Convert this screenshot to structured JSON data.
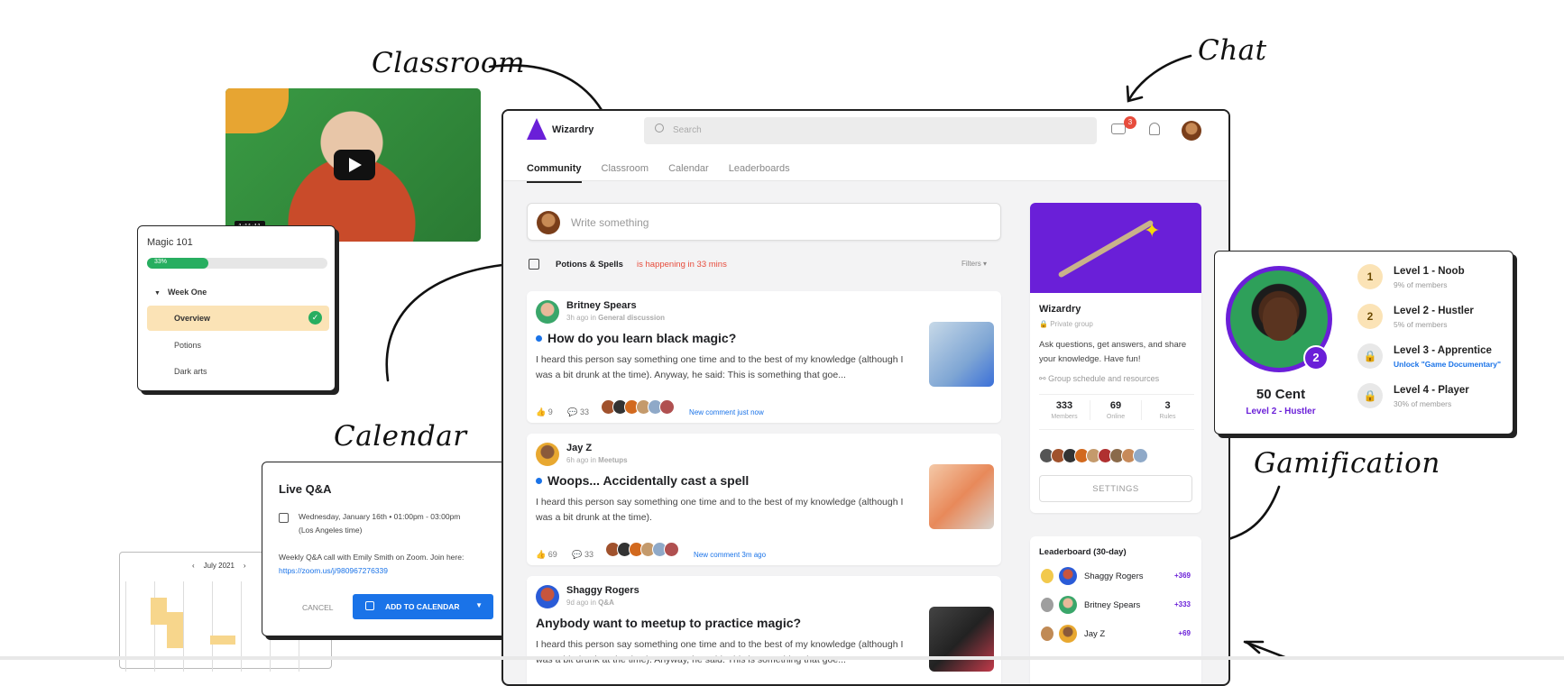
{
  "annotations": {
    "classroom": "Classroom",
    "chat": "Chat",
    "calendar": "Calendar",
    "gamification": "Gamification"
  },
  "video": {
    "timestamp": "1:11:11"
  },
  "course": {
    "title": "Magic 101",
    "progress_label": "33%",
    "progress_value": 0.33,
    "section": "Week One",
    "lessons": [
      "Overview",
      "Potions",
      "Dark arts"
    ]
  },
  "event": {
    "title": "Live Q&A",
    "datetime": "Wednesday, January 16th • 01:00pm - 03:00pm",
    "timezone": "(Los Angeles time)",
    "description": "Weekly Q&A call with Emily Smith on Zoom. Join here:",
    "link": "https://zoom.us/j/980967276339",
    "cancel_label": "CANCEL",
    "add_label": "ADD TO CALENDAR"
  },
  "calendar_widget": {
    "month": "July 2021"
  },
  "app": {
    "name": "Wizardry",
    "search_placeholder": "Search",
    "chat_badge": "3",
    "tabs": [
      "Community",
      "Classroom",
      "Calendar",
      "Leaderboards"
    ],
    "composer_placeholder": "Write something",
    "banner_event": "Potions & Spells",
    "banner_status": "is happening in 33 mins",
    "filters_label": "Filters",
    "posts": [
      {
        "author": "Britney Spears",
        "meta_time": "3h ago in",
        "meta_category": "General discussion",
        "title": "How do you learn black magic?",
        "body": "I heard this person say something one time and to the best of my knowledge (although I was a bit drunk at the time). Anyway, he said: This is something that goe...",
        "likes": "9",
        "comments": "33",
        "activity": "New comment just now"
      },
      {
        "author": "Jay Z",
        "meta_time": "6h ago in",
        "meta_category": "Meetups",
        "title": "Woops... Accidentally cast a spell",
        "body": "I heard this person say something one time and to the best of my knowledge (although I was a bit drunk at the time).",
        "likes": "69",
        "comments": "33",
        "activity": "New comment 3m ago"
      },
      {
        "author": "Shaggy Rogers",
        "meta_time": "9d ago in",
        "meta_category": "Q&A",
        "title": "Anybody want to meetup to practice magic?",
        "body": "I heard this person say something one time and to the best of my knowledge (although I was a bit drunk at the time). Anyway, he said: This is something that goe...",
        "likes": "",
        "comments": "",
        "activity": ""
      }
    ],
    "group": {
      "name": "Wizardry",
      "privacy": "Private group",
      "description": "Ask questions, get answers, and share your knowledge. Have fun!",
      "link": "Group schedule and resources",
      "stats": [
        {
          "value": "333",
          "label": "Members"
        },
        {
          "value": "69",
          "label": "Online"
        },
        {
          "value": "3",
          "label": "Rules"
        }
      ],
      "settings_label": "SETTINGS"
    },
    "leaderboard": {
      "title": "Leaderboard (30-day)",
      "rows": [
        {
          "name": "Shaggy Rogers",
          "points": "+369"
        },
        {
          "name": "Britney Spears",
          "points": "+333"
        },
        {
          "name": "Jay Z",
          "points": "+69"
        }
      ]
    }
  },
  "profile": {
    "name": "50 Cent",
    "level_label": "Level 2 - Hustler",
    "level_badge": "2",
    "levels": [
      {
        "num": "1",
        "title": "Level 1 - Noob",
        "sub": "9% of members"
      },
      {
        "num": "2",
        "title": "Level 2 - Hustler",
        "sub": "5% of members"
      },
      {
        "num": "",
        "title": "Level 3 - Apprentice",
        "sub": "Unlock \"Game Documentary\""
      },
      {
        "num": "",
        "title": "Level 4 - Player",
        "sub": "30% of members"
      }
    ]
  },
  "colors": {
    "accent": "#1a73e8",
    "purple": "#6a1fd8",
    "progress": "#27ae60",
    "danger": "#e74c3c"
  }
}
